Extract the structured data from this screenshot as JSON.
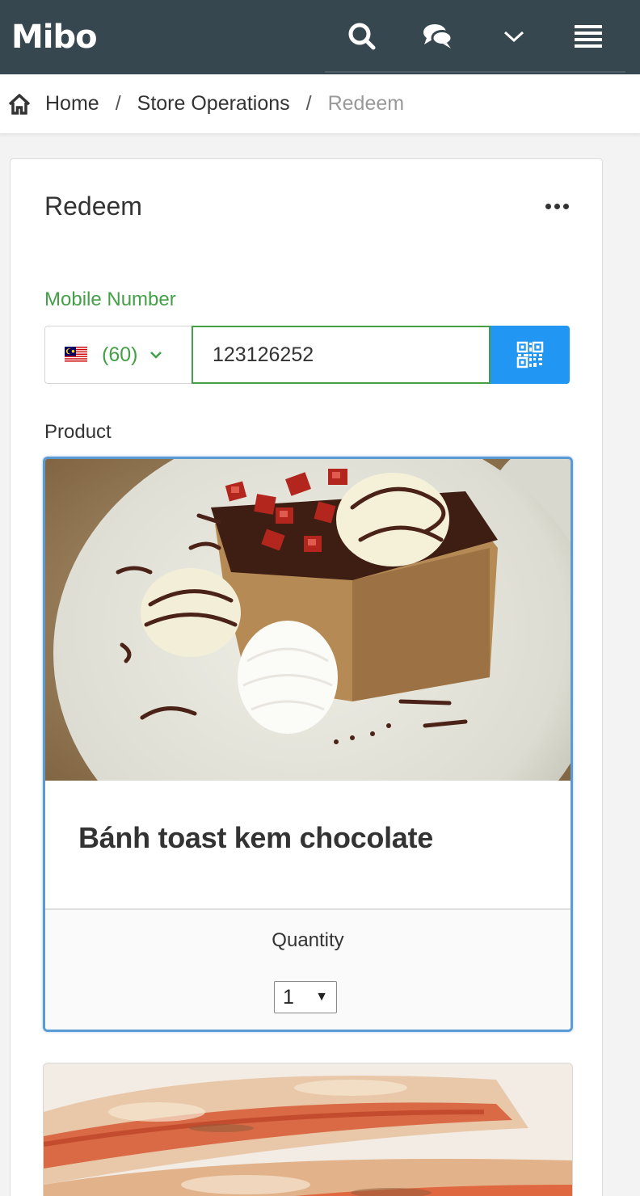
{
  "app": {
    "logo": "Mibo"
  },
  "header": {
    "icons": [
      "search-icon",
      "chat-icon",
      "chevron-down-icon",
      "hamburger-menu-icon"
    ],
    "colors": {
      "bar": "#37474f",
      "icon": "#ffffff"
    }
  },
  "breadcrumb": {
    "items": [
      {
        "label": "Home"
      },
      {
        "label": "Store Operations"
      },
      {
        "label": "Redeem"
      }
    ],
    "separator": "/"
  },
  "page": {
    "title": "Redeem",
    "mobile": {
      "label": "Mobile Number",
      "country_code": "(60)",
      "country": "Malaysia",
      "number": "123126252"
    },
    "product_label": "Product",
    "products": [
      {
        "name": "Bánh toast kem chocolate",
        "selected": true,
        "quantity_label": "Quantity",
        "quantity": "1"
      }
    ]
  },
  "colors": {
    "accent_green": "#43a047",
    "accent_blue": "#2196f3",
    "selected_border": "#5b9bd5"
  }
}
